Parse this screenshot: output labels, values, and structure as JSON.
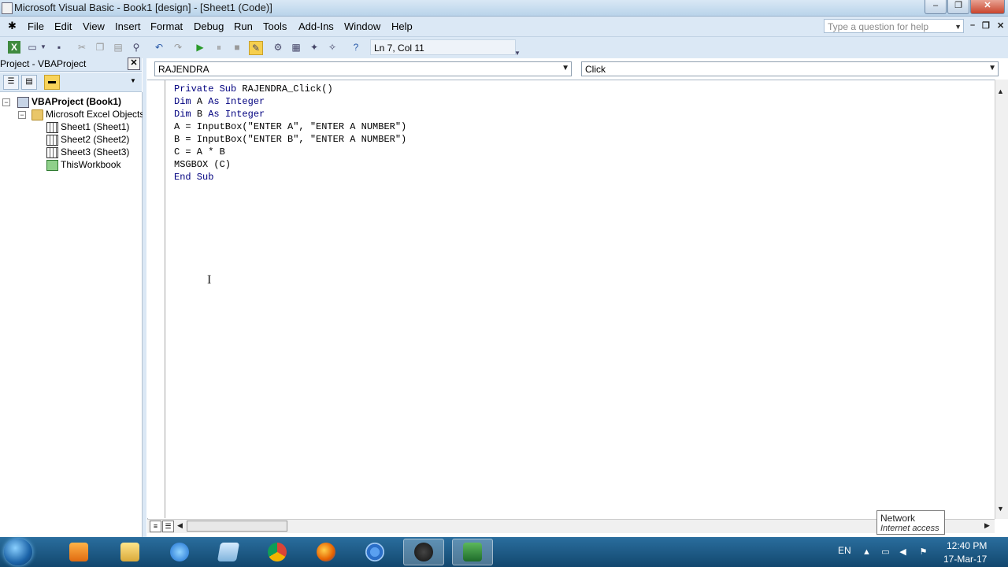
{
  "window": {
    "title": "Microsoft Visual Basic - Book1 [design] - [Sheet1 (Code)]",
    "minimize_glyph": "–",
    "restore_glyph": "❐",
    "close_glyph": "✕"
  },
  "menu": {
    "items": [
      "File",
      "Edit",
      "View",
      "Insert",
      "Format",
      "Debug",
      "Run",
      "Tools",
      "Add-Ins",
      "Window",
      "Help"
    ],
    "help_placeholder": "Type a question for help",
    "mdi_minimize": "–",
    "mdi_restore": "❐",
    "mdi_close": "✕"
  },
  "toolbar": {
    "status": "Ln 7, Col 11"
  },
  "project": {
    "title": "Project - VBAProject",
    "close_glyph": "✕",
    "tree": {
      "root": "VBAProject (Book1)",
      "folder": "Microsoft Excel Objects",
      "items": [
        "Sheet1 (Sheet1)",
        "Sheet2 (Sheet2)",
        "Sheet3 (Sheet3)",
        "ThisWorkbook"
      ]
    }
  },
  "code": {
    "object_combo": "RAJENDRA",
    "procedure_combo": "Click",
    "lines": [
      "Private Sub RAJENDRA_Click()",
      "Dim A As Integer",
      "Dim B As Integer",
      "A = InputBox(\"ENTER A\", \"ENTER A NUMBER\")",
      "B = InputBox(\"ENTER B\", \"ENTER A NUMBER\")",
      "C = A * B",
      "MSGBOX (C)",
      "End Sub"
    ]
  },
  "tooltip": {
    "title": "Network",
    "status": "Internet access"
  },
  "taskbar": {
    "language": "EN",
    "time": "12:40 PM",
    "date": "17-Mar-17"
  },
  "colors": {
    "keyword": "#00007f",
    "chrome": "#dbe8f5",
    "taskbar": "#1a5a88"
  }
}
